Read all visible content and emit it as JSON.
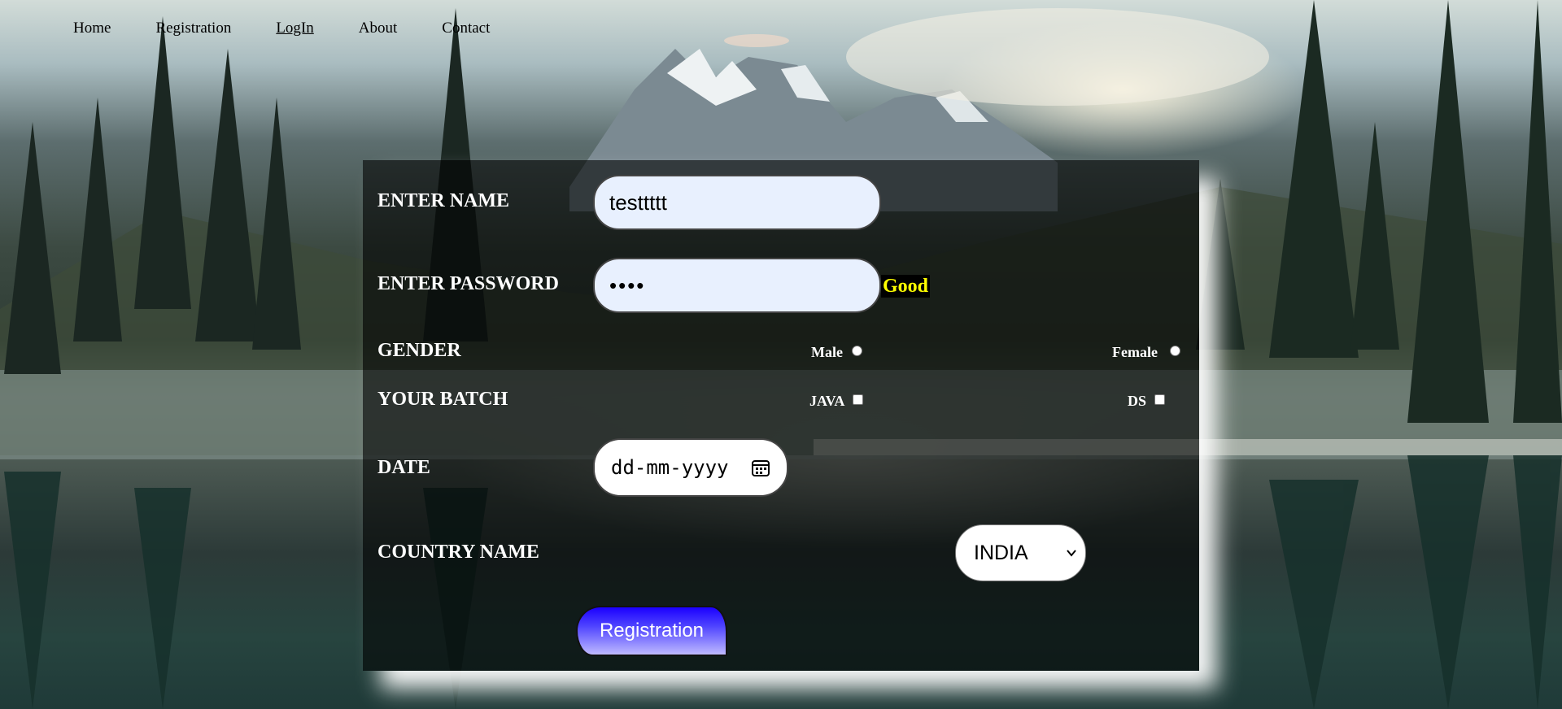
{
  "nav": {
    "items": [
      "Home",
      "Registration",
      "LogIn",
      "About",
      "Contact"
    ]
  },
  "form": {
    "name_label": "ENTER NAME",
    "name_value": "testtttt",
    "password_label": "ENTER PASSWORD",
    "password_value": "••••",
    "password_strength": "Good",
    "gender_label": "GENDER",
    "gender_options": [
      "Male",
      "Female"
    ],
    "batch_label": "YOUR BATCH",
    "batch_options": [
      "JAVA",
      "DS"
    ],
    "date_label": "DATE",
    "date_placeholder": "dd-mm-yyyy",
    "country_label": "COUNTRY NAME",
    "country_selected": "INDIA",
    "submit_label": "Registration"
  },
  "colors": {
    "strength_text": "#ffff00",
    "strength_bg": "#000000",
    "autofill_bg": "#e8f0fe",
    "button_gradient_top": "#1b00ff",
    "button_gradient_bottom": "#bfbaff"
  },
  "icons": {
    "date": "calendar-icon",
    "select": "chevron-down-icon"
  }
}
